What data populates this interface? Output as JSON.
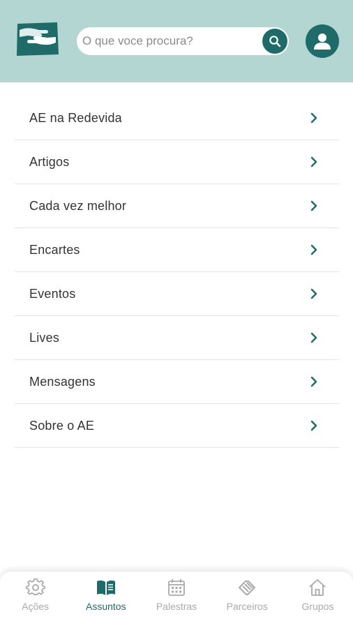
{
  "header": {
    "search": {
      "placeholder": "O que voce procura?",
      "value": ""
    }
  },
  "menu": {
    "items": [
      {
        "label": "AE na Redevida"
      },
      {
        "label": "Artigos"
      },
      {
        "label": "Cada vez melhor"
      },
      {
        "label": "Encartes"
      },
      {
        "label": "Eventos"
      },
      {
        "label": "Lives"
      },
      {
        "label": "Mensagens"
      },
      {
        "label": "Sobre o AE"
      }
    ]
  },
  "bottom_nav": {
    "items": [
      {
        "label": "Ações",
        "icon": "gear-icon",
        "active": false
      },
      {
        "label": "Assuntos",
        "icon": "book-icon",
        "active": true
      },
      {
        "label": "Palestras",
        "icon": "calendar-icon",
        "active": false
      },
      {
        "label": "Parceiros",
        "icon": "handshake-icon",
        "active": false
      },
      {
        "label": "Grupos",
        "icon": "home-icon",
        "active": false
      }
    ]
  },
  "colors": {
    "header_bg": "#b3d6d2",
    "accent": "#1f6b69",
    "inactive": "#a9a9a9"
  }
}
